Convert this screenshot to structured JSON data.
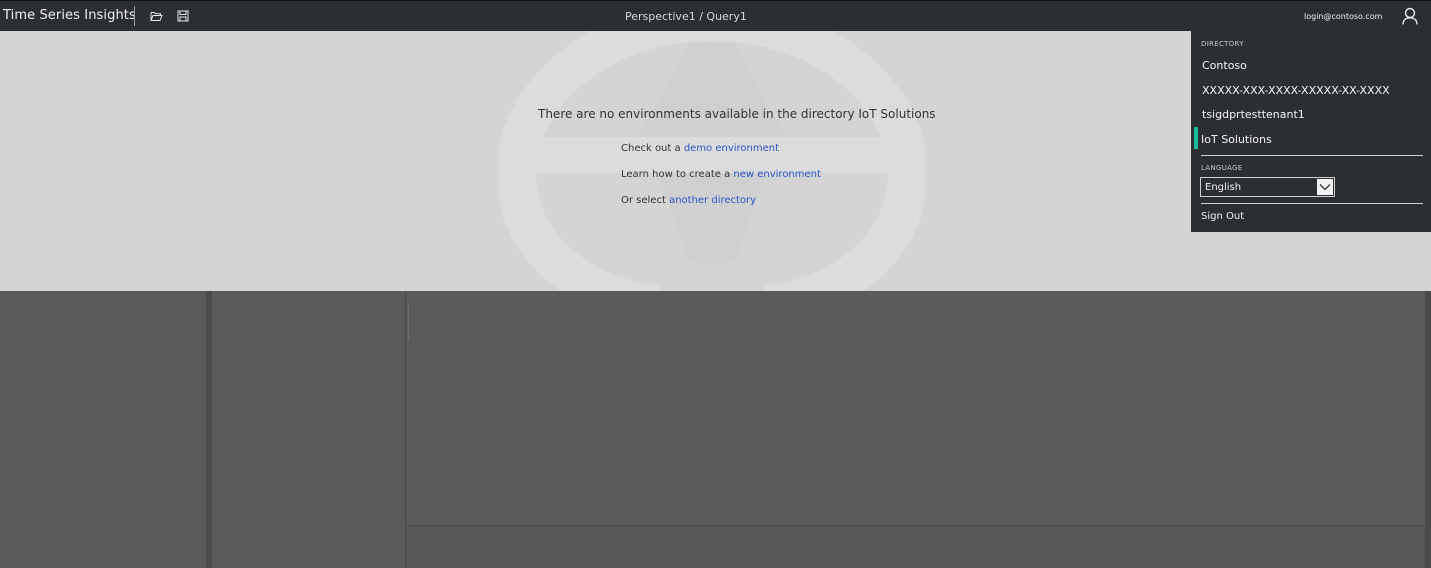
{
  "topbar": {
    "app_title": "Time Series Insights",
    "breadcrumb": "Perspective1 / Query1",
    "user_email": "login@contoso.com",
    "icons": [
      "folder-open-icon",
      "save-icon",
      "user-icon"
    ]
  },
  "message": {
    "no_environments": "There are no environments available in the directory IoT Solutions",
    "line1_prefix": "Check out a ",
    "line1_link": "demo environment",
    "line2_prefix": "Learn how to create a ",
    "line2_link": "new environment",
    "line3_prefix": "Or select ",
    "line3_link": "another directory"
  },
  "menu": {
    "directory_label": "DIRECTORY",
    "directories": [
      "Contoso",
      "XXXXX-XXX-XXXX-XXXXX-XX-XXXX",
      "tsigdprtesttenant1",
      "IoT Solutions"
    ],
    "selected_directory": "IoT Solutions",
    "language_label": "LANGUAGE",
    "language_value": "English",
    "sign_out": "Sign Out"
  },
  "colors": {
    "topbar_bg": "#2b2f33",
    "overlay_bg": "#d4d4d4",
    "link": "#2b55c7",
    "active_indicator": "#19b89a"
  }
}
